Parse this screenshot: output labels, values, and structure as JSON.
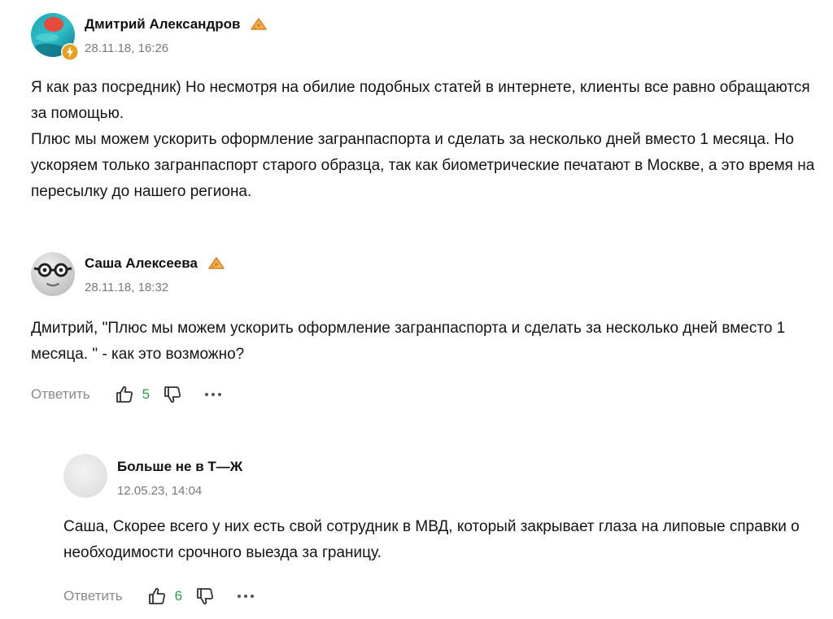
{
  "comments": [
    {
      "author": "Дмитрий Александров",
      "date": "28.11.18, 16:26",
      "paragraphs": [
        "Я как раз посредник) Но несмотря на обилие подобных статей в интернете, клиенты все равно обращаются за помощью.",
        "Плюс мы можем ускорить оформление загранпаспорта и сделать за несколько дней вместо 1 месяца. Но ускоряем только загранпаспорт старого образца, так как биометрические печатают в Москве, а это время на пересылку до нашего региона."
      ],
      "icons": {
        "avatar": "swimmer-photo-avatar",
        "avatar_badge": "lightning-badge-icon",
        "author_badge": "cheese-badge-icon"
      }
    },
    {
      "author": "Саша Алексеева",
      "date": "28.11.18, 18:32",
      "paragraphs": [
        "Дмитрий, \"Плюс мы можем ускорить оформление загранпаспорта и сделать за несколько дней вместо 1 месяца. \" - как это возможно?"
      ],
      "reply_label": "Ответить",
      "likes": "5",
      "icons": {
        "avatar": "glasses-face-avatar",
        "author_badge": "cheese-badge-icon"
      }
    },
    {
      "author": "Больше не в Т—Ж",
      "date": "12.05.23, 14:04",
      "paragraphs": [
        "Саша, Скорее всего у них есть свой сотрудник в МВД, который закрывает глаза на липовые справки о необходимости срочного выезда за границу."
      ],
      "reply_label": "Ответить",
      "likes": "6",
      "icons": {
        "avatar": "empty-gray-avatar"
      }
    }
  ],
  "colors": {
    "likes": "#2f9a4a",
    "meta": "#7a7a7a",
    "reply": "#8a8a8a",
    "badge_orange": "#f0a030",
    "avatar_badge": "#e8a020"
  }
}
